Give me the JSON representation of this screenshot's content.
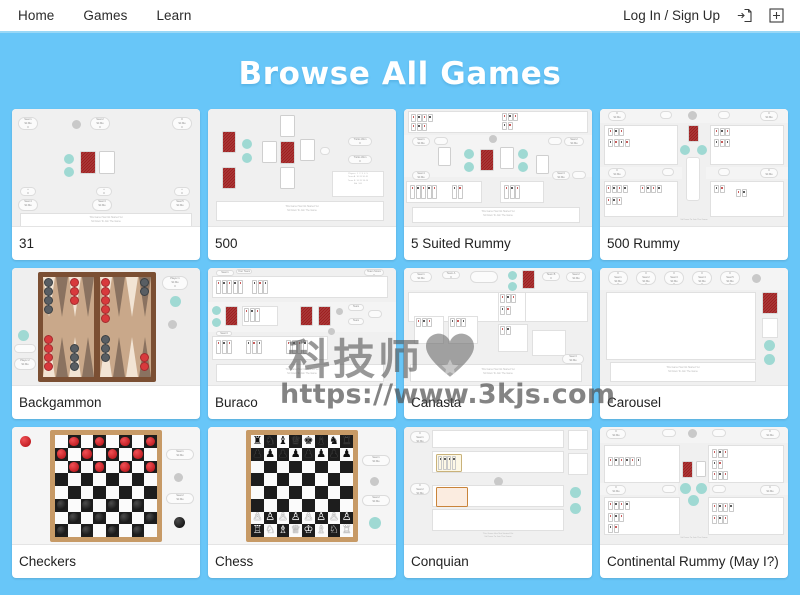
{
  "theme": {
    "background": "#68c6f8",
    "navbar_background": "#ffffff",
    "navbar_border": "#9ad8f6",
    "card_background": "#ffffff",
    "thumb_background": "#f0f0f0",
    "title_color": "#ffffff",
    "text_color": "#222222",
    "accent_red": "#9e2020",
    "accent_teal": "#9fd9d3",
    "board_wood": "#c79a66",
    "backgammon_felt": "#c9a88a"
  },
  "navbar": {
    "links": [
      {
        "label": "Home",
        "name": "nav-link-home"
      },
      {
        "label": "Games",
        "name": "nav-link-games"
      },
      {
        "label": "Learn",
        "name": "nav-link-learn"
      }
    ],
    "auth_label": "Log In / Sign Up",
    "icons": [
      {
        "name": "login-page-icon",
        "glyph": "login"
      },
      {
        "name": "new-table-plus-icon",
        "glyph": "plus-square"
      }
    ]
  },
  "page": {
    "title": "Browse All Games"
  },
  "games": [
    {
      "label": "31",
      "thumb": "thirty-one"
    },
    {
      "label": "500",
      "thumb": "five-hundred"
    },
    {
      "label": "5 Suited Rummy",
      "thumb": "five-suited-rummy"
    },
    {
      "label": "500 Rummy",
      "thumb": "five-hundred-rummy"
    },
    {
      "label": "Backgammon",
      "thumb": "backgammon"
    },
    {
      "label": "Buraco",
      "thumb": "buraco"
    },
    {
      "label": "Canasta",
      "thumb": "canasta"
    },
    {
      "label": "Carousel",
      "thumb": "carousel"
    },
    {
      "label": "Checkers",
      "thumb": "checkers"
    },
    {
      "label": "Chess",
      "thumb": "chess"
    },
    {
      "label": "Conquian",
      "thumb": "conquian"
    },
    {
      "label": "Continental Rummy (May I?)",
      "thumb": "continental-rummy"
    }
  ],
  "watermark": {
    "text_cn": "科技师",
    "url": "https://www.3kjs.com",
    "icon": "heart-icon"
  }
}
